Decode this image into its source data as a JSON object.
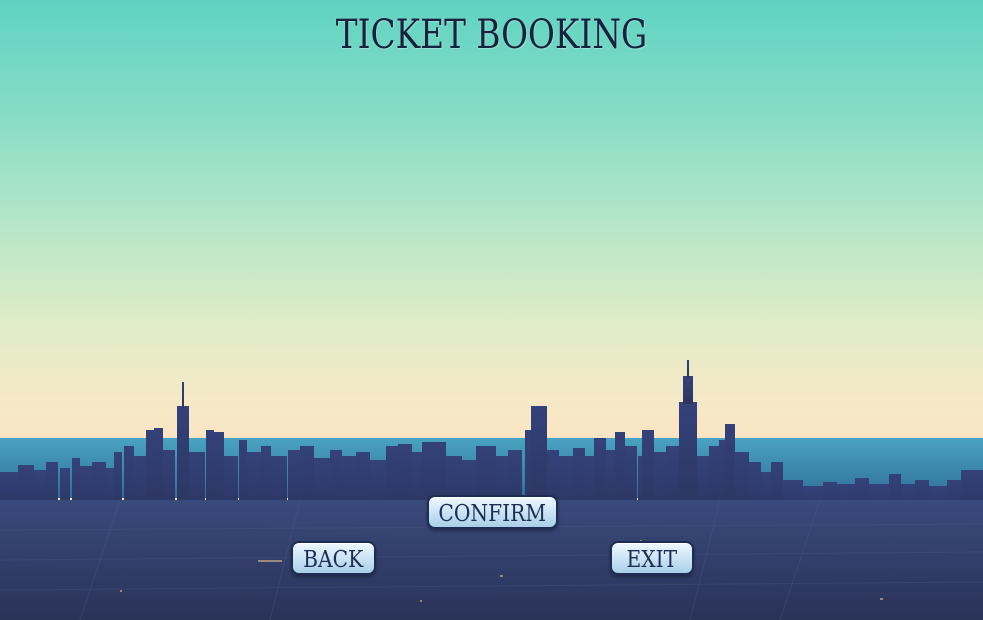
{
  "title": "TICKET BOOKING",
  "buttons": {
    "confirm": "CONFIRM",
    "back": "BACK",
    "exit": "EXIT"
  },
  "colors": {
    "sky_top": "#5fd3c2",
    "sky_horizon": "#fae6c5",
    "lake": "#3a8fb0",
    "city": "#2e3a66",
    "button_text": "#1f2d55"
  }
}
